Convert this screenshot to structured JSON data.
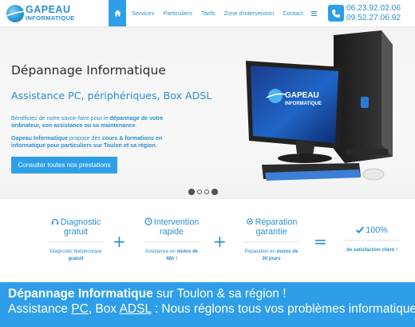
{
  "header": {
    "logo": {
      "line1": "GAPEAU",
      "line2": "INFORMATIQUE"
    },
    "nav": [
      {
        "label": "Services"
      },
      {
        "label": "Particuliers"
      },
      {
        "label": "Tarifs"
      },
      {
        "label": "Zone d'intervention"
      },
      {
        "label": "Contact"
      }
    ],
    "phones": [
      "06.23.92.02.06",
      "09.52.27.06.92"
    ],
    "icons": {
      "home": "home-icon",
      "menu": "menu-icon",
      "phone": "phone-icon"
    }
  },
  "hero": {
    "title": "Dépannage Informatique",
    "subtitle": "Assistance PC, périphériques, Box ADSL",
    "p1_a": "Bénéficiez de notre savoir-faire pour le ",
    "p1_b": "dépannage de votre ordinateur, son assistance ou sa maintenance",
    "p1_c": ".",
    "p2_a": "Gapeau Informatique",
    "p2_b": " propose des ",
    "p2_c": "cours & formations en informatique pour particuliers sur Toulon et sa région",
    "p2_d": ".",
    "cta": "Consulter toutes nos prestations",
    "screen_logo_line1": "GAPEAU",
    "screen_logo_line2": "INFORMATIQUE"
  },
  "features": [
    {
      "icon": "headset-icon",
      "title_l1": "Diagnostic",
      "title_l2": "gratuit",
      "desc_l1": "Diagnostic téléphonique",
      "desc_l2": "gratuit"
    },
    {
      "icon": "clock-icon",
      "title_l1": "Intervention",
      "title_l2": "rapide",
      "desc_l1a": "Assistance en ",
      "desc_l1b": "moins de",
      "desc_l2": "48h !"
    },
    {
      "icon": "gear-icon",
      "title_l1": "Réparation",
      "title_l2": "garantie",
      "desc_l1a": "Réparation en ",
      "desc_l1b": "moins de",
      "desc_l2": "30 jours"
    },
    {
      "icon": "check-icon",
      "title_l1": "100%",
      "desc_l1": "de satisfaction client !"
    }
  ],
  "operators": [
    "+",
    "+",
    "="
  ],
  "banner": {
    "l1_bold": "Dépannage Informatique",
    "l1_rest": " sur Toulon & sa région !",
    "l2_a": "Assistance ",
    "l2_pc": "PC",
    "l2_b": ", Box ",
    "l2_adsl": "ADSL",
    "l2_c": " : Nous réglons tous vos problèmes informatiques !"
  },
  "colors": {
    "accent": "#2e9ee8",
    "text_blue": "#2a8fd0"
  }
}
